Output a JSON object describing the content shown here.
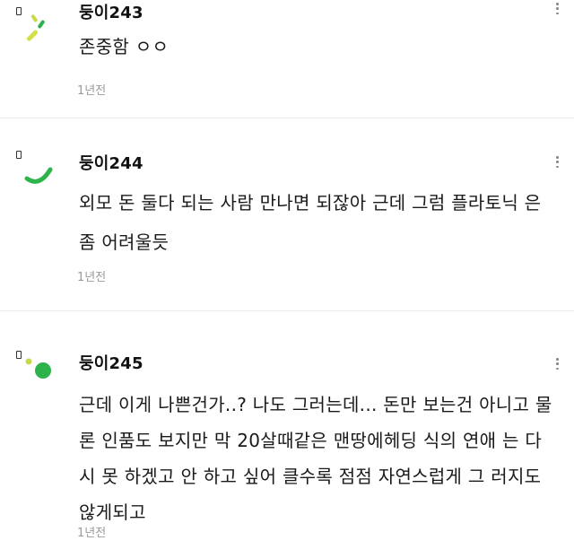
{
  "comments": [
    {
      "nickname": "둥이243",
      "text": "존중함 ㅇㅇ",
      "time": "1년전",
      "avatar": "green-strokes-avatar"
    },
    {
      "nickname": "둥이244",
      "text": "외모 돈 둘다 되는 사람 만나면 되잖아 근데 그럼 플라토닉 은 좀 어려울듯",
      "time": "1년전",
      "avatar": "green-arc-avatar"
    },
    {
      "nickname": "둥이245",
      "text": "근데 이게 나쁜건가..? 나도 그러는데... 돈만 보는건 아니고 물론 인품도 보지만 막 20살때같은 맨땅에헤딩 식의 연애 는 다시 못 하겠고 안 하고 싶어 클수록 점점 자연스럽게 그 러지도 않게되고",
      "time": "1년전",
      "avatar": "green-dots-avatar"
    }
  ],
  "colors": {
    "accent_green": "#2db34a",
    "accent_lime": "#c8d94a",
    "timestamp_gray": "#9a9a9a"
  }
}
